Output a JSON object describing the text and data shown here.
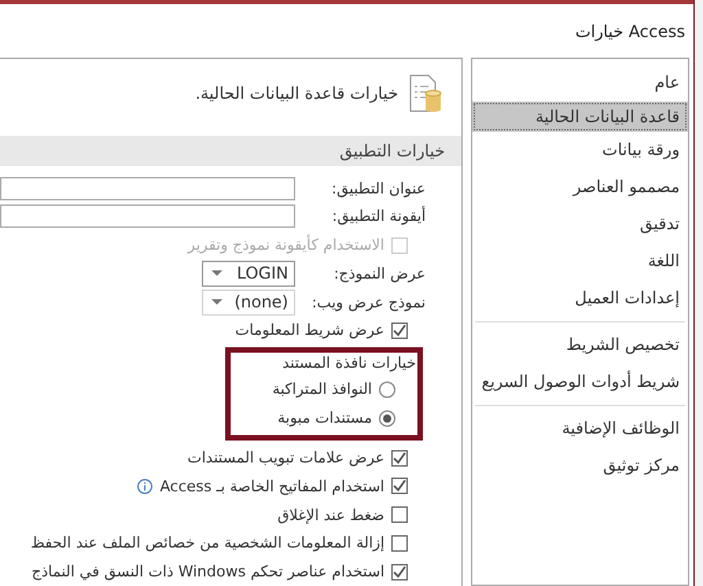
{
  "window": {
    "title": "خيارات Access"
  },
  "sidebar": {
    "groups": [
      [
        {
          "label": "عام",
          "selected": false
        },
        {
          "label": "قاعدة البيانات الحالية",
          "selected": true
        },
        {
          "label": "ورقة بيانات",
          "selected": false
        },
        {
          "label": "مصممو العناصر",
          "selected": false
        },
        {
          "label": "تدقيق",
          "selected": false
        },
        {
          "label": "اللغة",
          "selected": false
        },
        {
          "label": "إعدادات العميل",
          "selected": false
        }
      ],
      [
        {
          "label": "تخصيص الشريط",
          "selected": false
        },
        {
          "label": "شريط أدوات الوصول السريع",
          "selected": false
        }
      ],
      [
        {
          "label": "الوظائف الإضافية",
          "selected": false
        },
        {
          "label": "مركز توثيق",
          "selected": false
        }
      ]
    ]
  },
  "content": {
    "heading": "خيارات قاعدة البيانات الحالية.",
    "section": "خيارات التطبيق",
    "rows": [
      {
        "kind": "text",
        "label": "عنوان التطبيق:"
      },
      {
        "kind": "text",
        "label": "أيقونة التطبيق:"
      },
      {
        "kind": "checkbox",
        "label": "الاستخدام كأيقونة نموذج وتقرير",
        "checked": false,
        "disabled": true
      },
      {
        "kind": "dropdown",
        "label": "عرض النموذج:",
        "value": "LOGIN",
        "disabled": false
      },
      {
        "kind": "dropdown",
        "label": "نموذج عرض ويب:",
        "value": "(none)",
        "disabled": true
      },
      {
        "kind": "checkbox",
        "label": "عرض شريط المعلومات",
        "checked": true,
        "disabled": false
      },
      {
        "kind": "group",
        "title": "خيارات نافذة المستند",
        "highlighted": true,
        "options": [
          {
            "label": "النوافذ المتراكبة",
            "selected": false
          },
          {
            "label": "مستندات مبوبة",
            "selected": true
          }
        ]
      },
      {
        "kind": "checkbox",
        "label": "عرض علامات تبويب المستندات",
        "checked": true,
        "disabled": false
      },
      {
        "kind": "checkbox",
        "label": "استخدام المفاتيح الخاصة بـ Access",
        "checked": true,
        "disabled": false,
        "info": true
      },
      {
        "kind": "checkbox",
        "label": "ضغط عند الإغلاق",
        "checked": false,
        "disabled": false
      },
      {
        "kind": "checkbox",
        "label": "إزالة المعلومات الشخصية من خصائص الملف عند الحفظ",
        "checked": false,
        "disabled": false
      },
      {
        "kind": "checkbox",
        "label": "استخدام عناصر تحكم Windows ذات النسق في النماذج",
        "checked": true,
        "disabled": false
      }
    ]
  }
}
